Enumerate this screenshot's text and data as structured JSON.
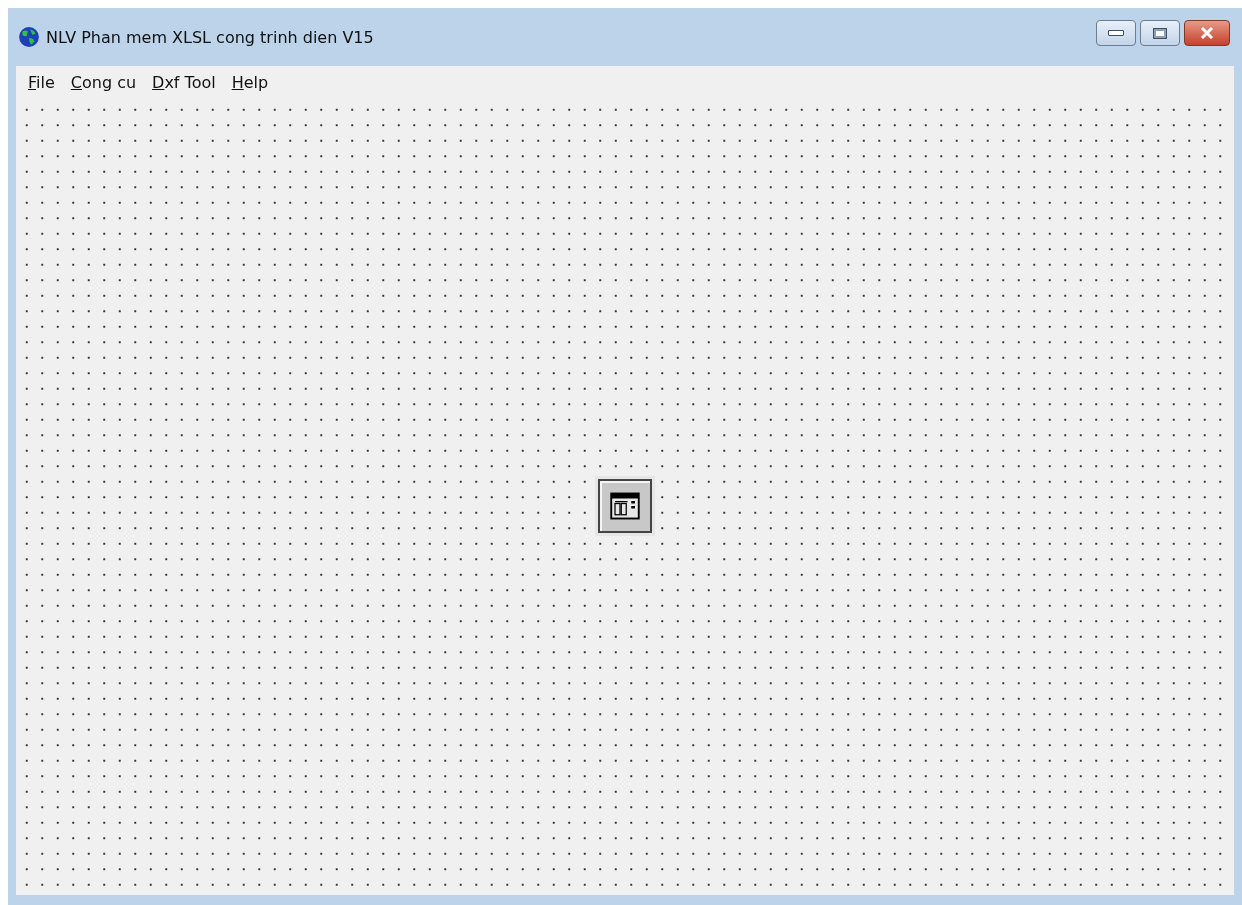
{
  "window": {
    "title": "NLV Phan mem XLSL cong trinh dien V15"
  },
  "menu": [
    {
      "label": "File"
    },
    {
      "label": "Cong cu"
    },
    {
      "label": "Dxf Tool"
    },
    {
      "label": "Help"
    }
  ]
}
